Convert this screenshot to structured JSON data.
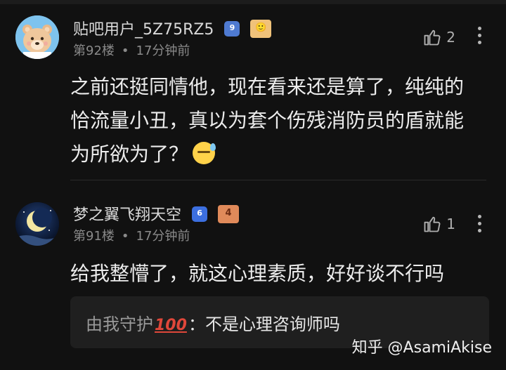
{
  "comments": [
    {
      "username": "贴吧用户_5Z75RZ5",
      "level_badge": "9",
      "fan_badge": "🙂",
      "floor": "第92楼",
      "separator": "•",
      "time": "17分钟前",
      "likes": "2",
      "text_lines": [
        "之前还挺同情他，现在看来还是算了，纯纯的",
        "恰流量小丑，真以为套个伤残消防员的盾就能",
        "为所欲为了？"
      ]
    },
    {
      "username": "梦之翼飞翔天空",
      "level_badge": "6",
      "fan_badge": "4",
      "floor": "第91楼",
      "separator": "•",
      "time": "17分钟前",
      "likes": "1",
      "text_lines": [
        "给我整懵了，就这心理素质，好好谈不行吗"
      ],
      "reply": {
        "name": "由我守护",
        "emoji_text": "100",
        "colon": "：",
        "text": "不是心理咨询师吗"
      }
    }
  ],
  "watermark": "知乎 @AsamiAkise",
  "icons": {
    "like": "thumbs-up-icon",
    "more": "more-vertical-icon",
    "sweat_emoji": "sweat-face-emoji-icon"
  },
  "colors": {
    "background": "#111111",
    "text": "#ececec",
    "muted": "#8a8a8a",
    "level_badge": "#4e7ad1",
    "reply_bg": "#1f1f1f",
    "hundred_red": "#e0473a"
  }
}
